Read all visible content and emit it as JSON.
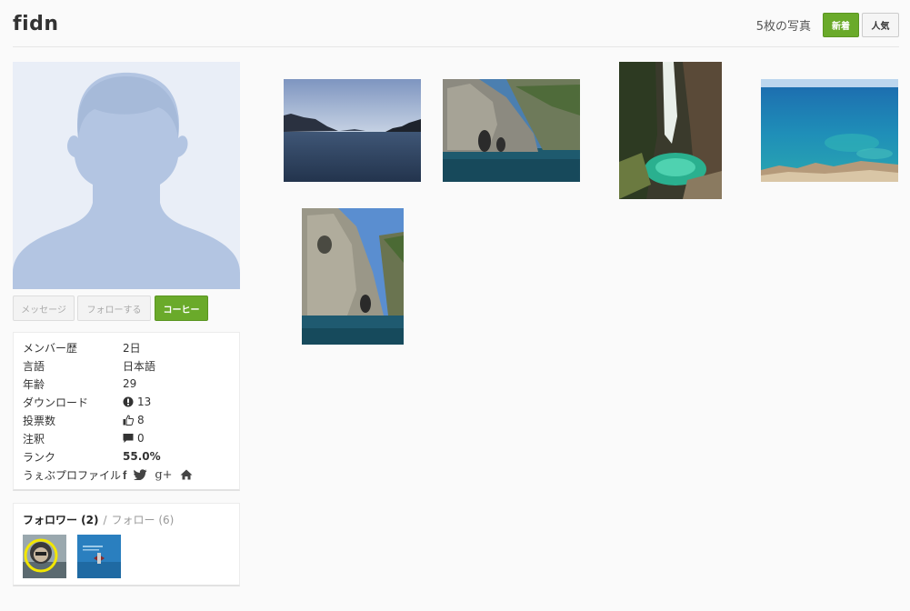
{
  "header": {
    "username": "fidn",
    "photo_count": "5枚の写真",
    "sort_new_label": "新着",
    "sort_popular_label": "人気"
  },
  "profile_actions": {
    "message_label": "メッセージ",
    "follow_label": "フォローする",
    "coffee_label": "コーヒー"
  },
  "info": {
    "member_since_label": "メンバー歴",
    "member_since_value": "2日",
    "language_label": "言語",
    "language_value": "日本語",
    "age_label": "年齢",
    "age_value": "29",
    "downloads_label": "ダウンロード",
    "downloads_value": "13",
    "votes_label": "投票数",
    "votes_value": "8",
    "comments_label": "注釈",
    "comments_value": "0",
    "rank_label": "ランク",
    "rank_value": "55.0%",
    "web_profiles_label": "うぇぶプロファイル",
    "social_facebook": "f",
    "social_google": "g+"
  },
  "follow": {
    "followers_label": "フォロワー (2)",
    "separator": "/",
    "following_label": "フォロー (6)"
  },
  "colors": {
    "accent_green": "#6aaa2a",
    "avatar_silhouette": "#b3c5e2",
    "avatar_bg": "#e9eef7"
  },
  "icons": {
    "download": "download-icon",
    "vote": "thumbs-up-icon",
    "comment": "comment-icon",
    "facebook": "facebook-icon",
    "twitter": "twitter-icon",
    "google_plus": "google-plus-icon",
    "home": "home-icon"
  }
}
